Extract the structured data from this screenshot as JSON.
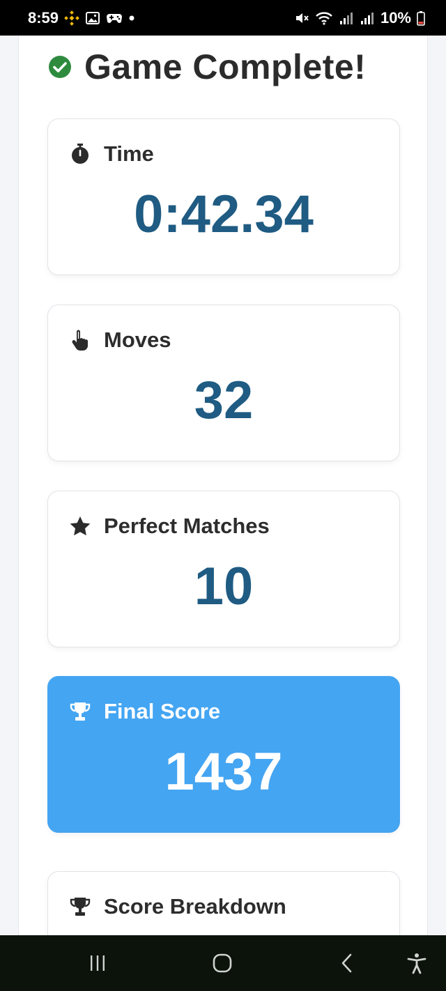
{
  "status_bar": {
    "time": "8:59",
    "battery": "10%",
    "left_icons": [
      "binance-icon",
      "gallery-icon",
      "game-controller-icon",
      "dot-icon"
    ],
    "right_icons": [
      "mute-icon",
      "wifi-icon",
      "signal-icon",
      "signal-icon",
      "battery-icon"
    ]
  },
  "header": {
    "title": "Game Complete!",
    "icon": "check-circle-icon",
    "icon_color": "#2e8b3e"
  },
  "stats": [
    {
      "label": "Time",
      "value": "0:42.34",
      "icon": "stopwatch-icon"
    },
    {
      "label": "Moves",
      "value": "32",
      "icon": "pointer-hand-icon"
    },
    {
      "label": "Perfect Matches",
      "value": "10",
      "icon": "star-icon"
    },
    {
      "label": "Final Score",
      "value": "1437",
      "icon": "trophy-icon",
      "highlight_color": "#44a5f2"
    }
  ],
  "breakdown": {
    "label": "Score Breakdown",
    "icon": "trophy-icon"
  },
  "colors": {
    "value_text": "#1f5b82",
    "accent": "#44a5f2"
  },
  "nav_bar": {
    "buttons": [
      "recent-apps-icon",
      "home-icon",
      "back-icon",
      "accessibility-icon"
    ]
  }
}
